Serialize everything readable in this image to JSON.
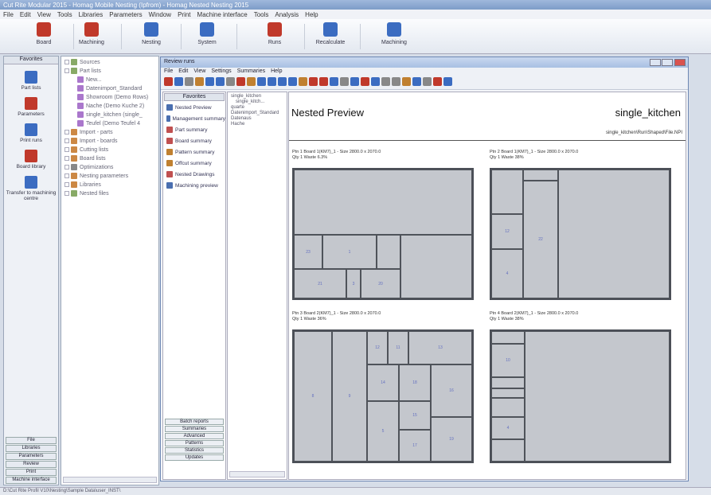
{
  "app": {
    "title": "Cut Rite Modular 2015 - Homag Mobile Nesting (Ipfrom) - Homag Nested Nesting 2015",
    "menu": [
      "File",
      "Edit",
      "View",
      "Tools",
      "Libraries",
      "Parameters",
      "Window",
      "Print",
      "Machine interface",
      "Tools",
      "Analysis",
      "Help"
    ]
  },
  "ribbon": [
    {
      "label": "Board",
      "icon": "board-icon",
      "color": "#c0392b"
    },
    {
      "label": "Machining",
      "icon": "machining-icon",
      "color": "#c0392b"
    },
    {
      "label": "Nesting",
      "icon": "nesting-icon",
      "color": "#3b6cc1"
    },
    {
      "label": "System",
      "icon": "system-icon",
      "color": "#3b6cc1"
    },
    {
      "label": "Runs",
      "icon": "runs-icon",
      "color": "#c0392b"
    },
    {
      "label": "Recalculate",
      "icon": "recalculate-icon",
      "color": "#3b6cc1"
    },
    {
      "label": "Machining",
      "icon": "machining2-icon",
      "color": "#3b6cc1"
    }
  ],
  "leftnav": {
    "header": "Favorites",
    "items": [
      {
        "label": "Part lists",
        "color": "#3b6cc1"
      },
      {
        "label": "Parameters",
        "color": "#c0392b"
      },
      {
        "label": "Print runs",
        "color": "#3b6cc1"
      },
      {
        "label": "Board library",
        "color": "#c0392b"
      },
      {
        "label": "Transfer to machining centre",
        "color": "#3b6cc1"
      }
    ],
    "footer": [
      "File",
      "Libraries",
      "Parameters",
      "Review",
      "Print",
      "Machine interface"
    ]
  },
  "tree": {
    "items": [
      {
        "label": "Sources",
        "indent": 0,
        "color": "#8a6"
      },
      {
        "label": "Part lists",
        "indent": 0,
        "color": "#8a6"
      },
      {
        "label": "New...",
        "indent": 2,
        "color": "#a7c"
      },
      {
        "label": "Datenimport_Standard",
        "indent": 2,
        "color": "#a7c"
      },
      {
        "label": "Showroom (Demo Rows)",
        "indent": 2,
        "color": "#a7c"
      },
      {
        "label": "Nache (Demo Kuche 2)",
        "indent": 2,
        "color": "#a7c"
      },
      {
        "label": "single_kitchen (single_",
        "indent": 2,
        "color": "#a7c"
      },
      {
        "label": "Teufel (Demo Teufel 4",
        "indent": 2,
        "color": "#a7c"
      },
      {
        "label": "Import - parts",
        "indent": 0,
        "color": "#c84"
      },
      {
        "label": "Import - boards",
        "indent": 0,
        "color": "#c84"
      },
      {
        "label": "Cutting lists",
        "indent": 0,
        "color": "#c84"
      },
      {
        "label": "Board lists",
        "indent": 0,
        "color": "#c84"
      },
      {
        "label": "Optimizations",
        "indent": 0,
        "color": "#888"
      },
      {
        "label": "Nesting parameters",
        "indent": 0,
        "color": "#c84"
      },
      {
        "label": "Libraries",
        "indent": 0,
        "color": "#c84"
      },
      {
        "label": "Nested files",
        "indent": 0,
        "color": "#8a6"
      }
    ]
  },
  "mdi": {
    "title": "Review runs",
    "menu": [
      "File",
      "Edit",
      "View",
      "Settings",
      "Summaries",
      "Help"
    ],
    "panel_header": "Favorites",
    "panel_items": [
      {
        "label": "Nested Preview",
        "color": "#4a6fb0"
      },
      {
        "label": "Management summary",
        "color": "#4a6fb0"
      },
      {
        "label": "Part summary",
        "color": "#c05050"
      },
      {
        "label": "Board summary",
        "color": "#c05050"
      },
      {
        "label": "Pattern summary",
        "color": "#c08030"
      },
      {
        "label": "Offcut summary",
        "color": "#c08030"
      },
      {
        "label": "Nested Drawings",
        "color": "#c05050"
      },
      {
        "label": "Machining preview",
        "color": "#4a6fb0"
      }
    ],
    "panel_footer": [
      "Batch reports",
      "Summaries",
      "Advanced",
      "Patterns",
      "Statistics",
      "Updates"
    ],
    "file_tree": [
      "single_kitchen",
      "single_kitch...",
      "quarte",
      "Datenimport_Standard",
      "Datenaus",
      "Hache"
    ]
  },
  "report": {
    "title": "Nested Preview",
    "run_name": "single_kitchen",
    "path": "single_kitchen\\Run\\Shaped\\File.NPI",
    "patterns": [
      {
        "line1": "Ptn 1  Board 1(KM7)_1 - Size 2800.0 x 2070.0",
        "line2": "Qty 1  Waste 6.3%"
      },
      {
        "line1": "Ptn 2  Board 1(KM7)_1 - Size 2800.0 x 2070.0",
        "line2": "Qty 1  Waste 38%"
      },
      {
        "line1": "Ptn 3  Board 2(KM7)_1 - Size 2800.0 x 2070.0",
        "line2": "Qty 1  Waste 36%"
      },
      {
        "line1": "Ptn 4  Board 2(KM7)_1 - Size 2800.0 x 2070.0",
        "line2": "Qty 1  Waste 38%"
      }
    ]
  },
  "status": "D:\\Cut Rite Profil V10\\Nesting\\Sample Data\\user_INST\\"
}
